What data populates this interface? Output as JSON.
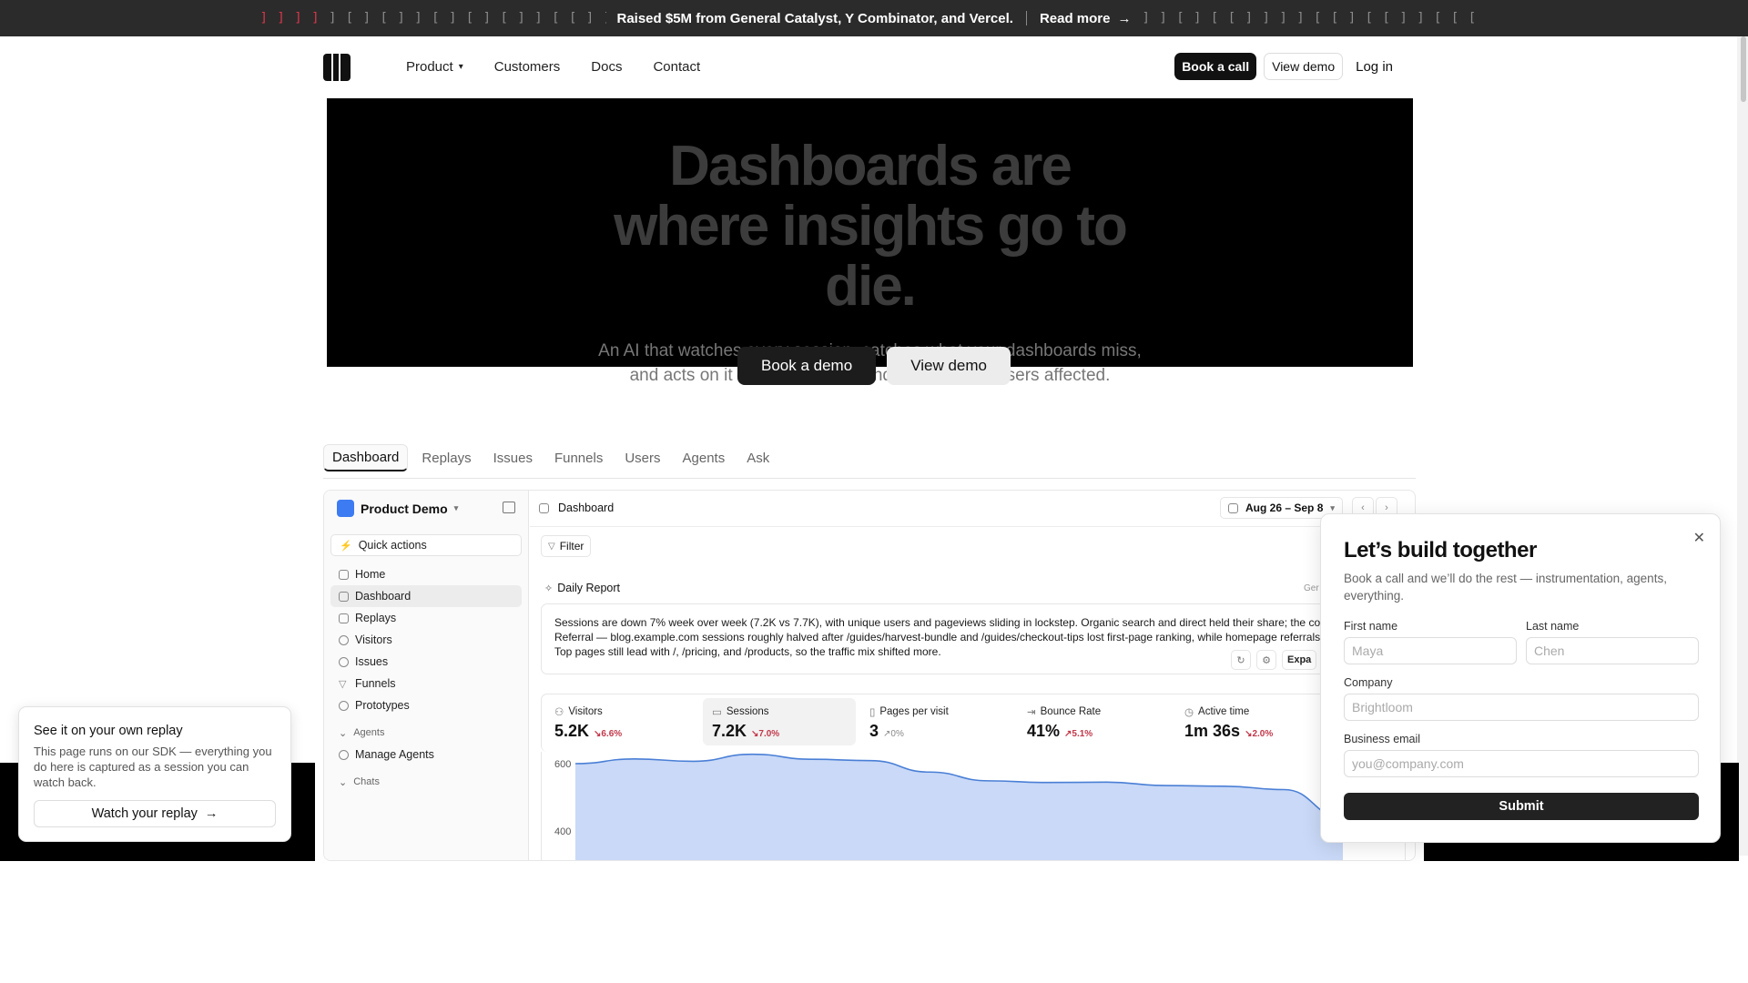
{
  "banner": {
    "text": "Raised $5M from General Catalyst, Y Combinator, and Vercel.",
    "read_more": "Read more"
  },
  "nav": {
    "links": [
      "Product",
      "Customers",
      "Docs",
      "Contact"
    ],
    "book_call": "Book a call",
    "view_demo": "View demo",
    "login": "Log in"
  },
  "hero": {
    "title": "Dashboards are where insights go to die.",
    "subtitle": "An AI that watches every session, catches what your dashboards miss, and acts on it — opening PRs and reaching the users affected.",
    "cta_primary": "Book a demo",
    "cta_secondary": "View demo"
  },
  "tabs": [
    "Dashboard",
    "Replays",
    "Issues",
    "Funnels",
    "Users",
    "Agents",
    "Ask"
  ],
  "app": {
    "workspace": "Product Demo",
    "quick_actions": "Quick actions",
    "menu": [
      "Home",
      "Dashboard",
      "Replays",
      "Visitors",
      "Issues",
      "Funnels",
      "Prototypes"
    ],
    "agents_group": "Agents",
    "manage_agents": "Manage Agents",
    "chats_group": "Chats",
    "header_title": "Dashboard",
    "date_range": "Aug 26 – Sep 8",
    "filter": "Filter",
    "daily_report_title": "Daily Report",
    "generated_label": "Ger",
    "report_text": "Sessions are down 7% week over week (7.2K vs 7.7K), with unique users and pageviews sliding in lockstep. Organic search and direct held their share; the concentrates in Referral — blog.example.com sessions roughly halved after /guides/harvest-bundle and /guides/checkout-tips lost first-page ranking, while homepage referrals barely moved. Top pages still lead with /, /pricing, and /products, so the traffic mix shifted more.",
    "expand_label": "Expa",
    "metrics": [
      {
        "label": "Visitors",
        "value": "5.2K",
        "delta": "↘6.6%"
      },
      {
        "label": "Sessions",
        "value": "7.2K",
        "delta": "↘7.0%"
      },
      {
        "label": "Pages per visit",
        "value": "3",
        "delta": "↗0%"
      },
      {
        "label": "Bounce Rate",
        "value": "41%",
        "delta": "↗5.1%"
      },
      {
        "label": "Active time",
        "value": "1m 36s",
        "delta": "↘2.0%"
      }
    ],
    "chart_ticks": [
      "600",
      "400"
    ]
  },
  "chart_data": {
    "type": "area",
    "series": [
      {
        "values": [
          600,
          614,
          607,
          628,
          613,
          609,
          575,
          549,
          544,
          545,
          535,
          533,
          523,
          440
        ]
      }
    ],
    "y_ticks": [
      400,
      600
    ],
    "ylim": [
      300,
      700
    ],
    "grid": false,
    "color": "#c9d9f7"
  },
  "modal": {
    "title": "Let’s build together",
    "subtitle": "Book a call and we’ll do the rest — instrumentation, agents, everything.",
    "first_name_label": "First name",
    "first_name_placeholder": "Maya",
    "last_name_label": "Last name",
    "last_name_placeholder": "Chen",
    "company_label": "Company",
    "company_placeholder": "Brightloom",
    "email_label": "Business email",
    "email_placeholder": "you@company.com",
    "submit": "Submit"
  },
  "toast": {
    "title": "See it on your own replay",
    "text": "This page runs on our SDK — everything you do here is captured as a session you can watch back.",
    "button": "Watch your replay"
  }
}
